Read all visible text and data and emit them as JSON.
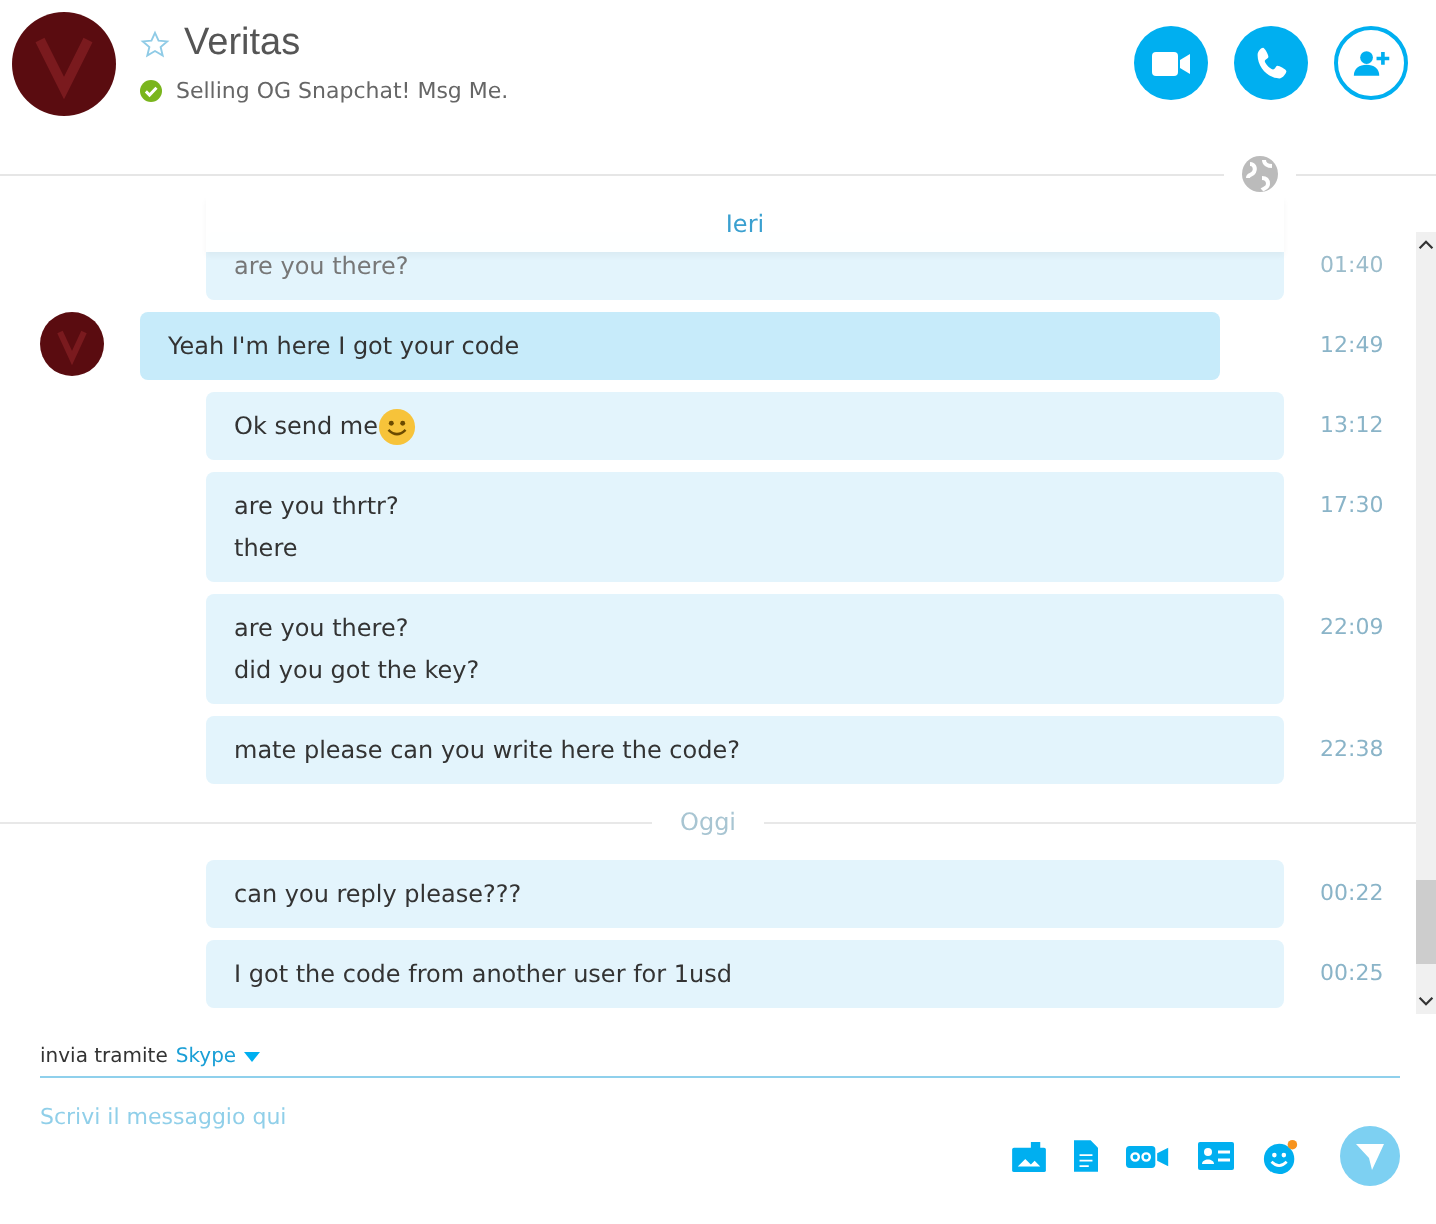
{
  "contact": {
    "name": "Veritas",
    "favorite": false,
    "mood": "Selling OG Snapchat! Msg Me.",
    "online": true
  },
  "floating_day": "Ieri",
  "messages": [
    {
      "kind": "outgoing",
      "lines": [
        "are you there?"
      ],
      "time": "01:40",
      "faded": true
    },
    {
      "kind": "incoming",
      "lines": [
        "Yeah I'm here I got your code"
      ],
      "time": "12:49",
      "faded": false
    },
    {
      "kind": "outgoing",
      "lines": [
        "Ok send me"
      ],
      "emoji": true,
      "time": "13:12",
      "faded": false
    },
    {
      "kind": "outgoing",
      "lines": [
        "are you thrtr?",
        "there"
      ],
      "time": "17:30",
      "faded": false
    },
    {
      "kind": "outgoing",
      "lines": [
        "are you there?",
        "did you got the key?"
      ],
      "time": "22:09",
      "faded": false
    },
    {
      "kind": "outgoing",
      "lines": [
        "mate please can you write here the code?"
      ],
      "time": "22:38",
      "faded": false
    },
    {
      "kind": "day",
      "label": "Oggi"
    },
    {
      "kind": "outgoing",
      "lines": [
        "can you reply please???"
      ],
      "time": "00:22",
      "faded": false
    },
    {
      "kind": "outgoing",
      "lines": [
        "I got the code from another user for 1usd"
      ],
      "time": "00:25",
      "faded": false
    }
  ],
  "composer": {
    "via_label": "invia tramite",
    "service": "Skype",
    "placeholder": "Scrivi il messaggio qui"
  }
}
